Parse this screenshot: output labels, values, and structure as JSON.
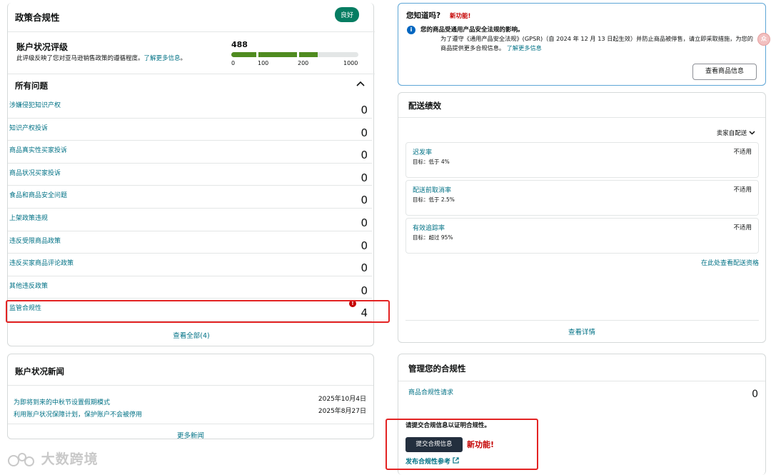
{
  "policy": {
    "title": "政策合规性",
    "status_badge": "良好",
    "rating": {
      "title": "账户状况评级",
      "description": "此评级反映了您对亚马逊销售政策的遵循程度。",
      "learn_more": "了解更多信息",
      "description_suffix": "。",
      "score": "488",
      "score_value": 488,
      "scale_max": 1000,
      "ticks": [
        "0",
        "100",
        "200",
        "1000"
      ]
    },
    "issues_title": "所有问题",
    "issues": [
      {
        "label": "涉嫌侵犯知识产权",
        "count": "0"
      },
      {
        "label": "知识产权投诉",
        "count": "0"
      },
      {
        "label": "商品真实性买家投诉",
        "count": "0"
      },
      {
        "label": "商品状况买家投诉",
        "count": "0"
      },
      {
        "label": "食品和商品安全问题",
        "count": "0"
      },
      {
        "label": "上架政策违规",
        "count": "0"
      },
      {
        "label": "违反受限商品政策",
        "count": "0"
      },
      {
        "label": "违反买家商品评论政策",
        "count": "0"
      },
      {
        "label": "其他违反政策",
        "count": "0"
      },
      {
        "label": "监管合规性",
        "count": "4",
        "alert": true
      }
    ],
    "view_all": "查看全部(4)"
  },
  "news": {
    "title": "账户状况新闻",
    "items": [
      {
        "label": "为即将到来的中秋节设置假期模式",
        "date": "2025年10月4日"
      },
      {
        "label": "利用账户状况保障计划，保护账户不会被停用",
        "date": "2025年8月27日"
      }
    ],
    "more": "更多新闻"
  },
  "watermark": {
    "text": "大数跨境"
  },
  "did_you_know": {
    "title": "您知道吗?",
    "new_label": "新功能!",
    "headline": "您的商品受通用产品安全法规的影响。",
    "body": "为了遵守《通用产品安全法规》(GPSR)（自 2024 年 12 月 13 日起生效）并防止商品被停售，请立即采取措施，为您的商品提供更多合规信息。",
    "learn_more": "了解更多信息",
    "button": "查看商品信息",
    "side_badge": "众"
  },
  "delivery": {
    "title": "配送绩效",
    "dropdown": "卖家自配送",
    "metrics": [
      {
        "label": "迟发率",
        "target": "目标：低于 4%",
        "value": "不适用"
      },
      {
        "label": "配送前取消率",
        "target": "目标：低于 2.5%",
        "value": "不适用"
      },
      {
        "label": "有效追踪率",
        "target": "目标：超过 95%",
        "value": "不适用"
      }
    ],
    "eligibility_link": "在此处查看配送资格",
    "details_link": "查看详情"
  },
  "manage": {
    "title": "管理您的合规性",
    "request_label": "商品合规性请求",
    "request_count": "0",
    "prompt": "请提交合规信息以证明合规性。",
    "submit_button": "提交合规信息",
    "new_label": "新功能!",
    "reference_link": "发布合规性参考"
  },
  "colors": {
    "accent_link": "#007185",
    "good_green": "#067d62",
    "alert_red": "#c40000",
    "highlight_box": "#e32323"
  }
}
